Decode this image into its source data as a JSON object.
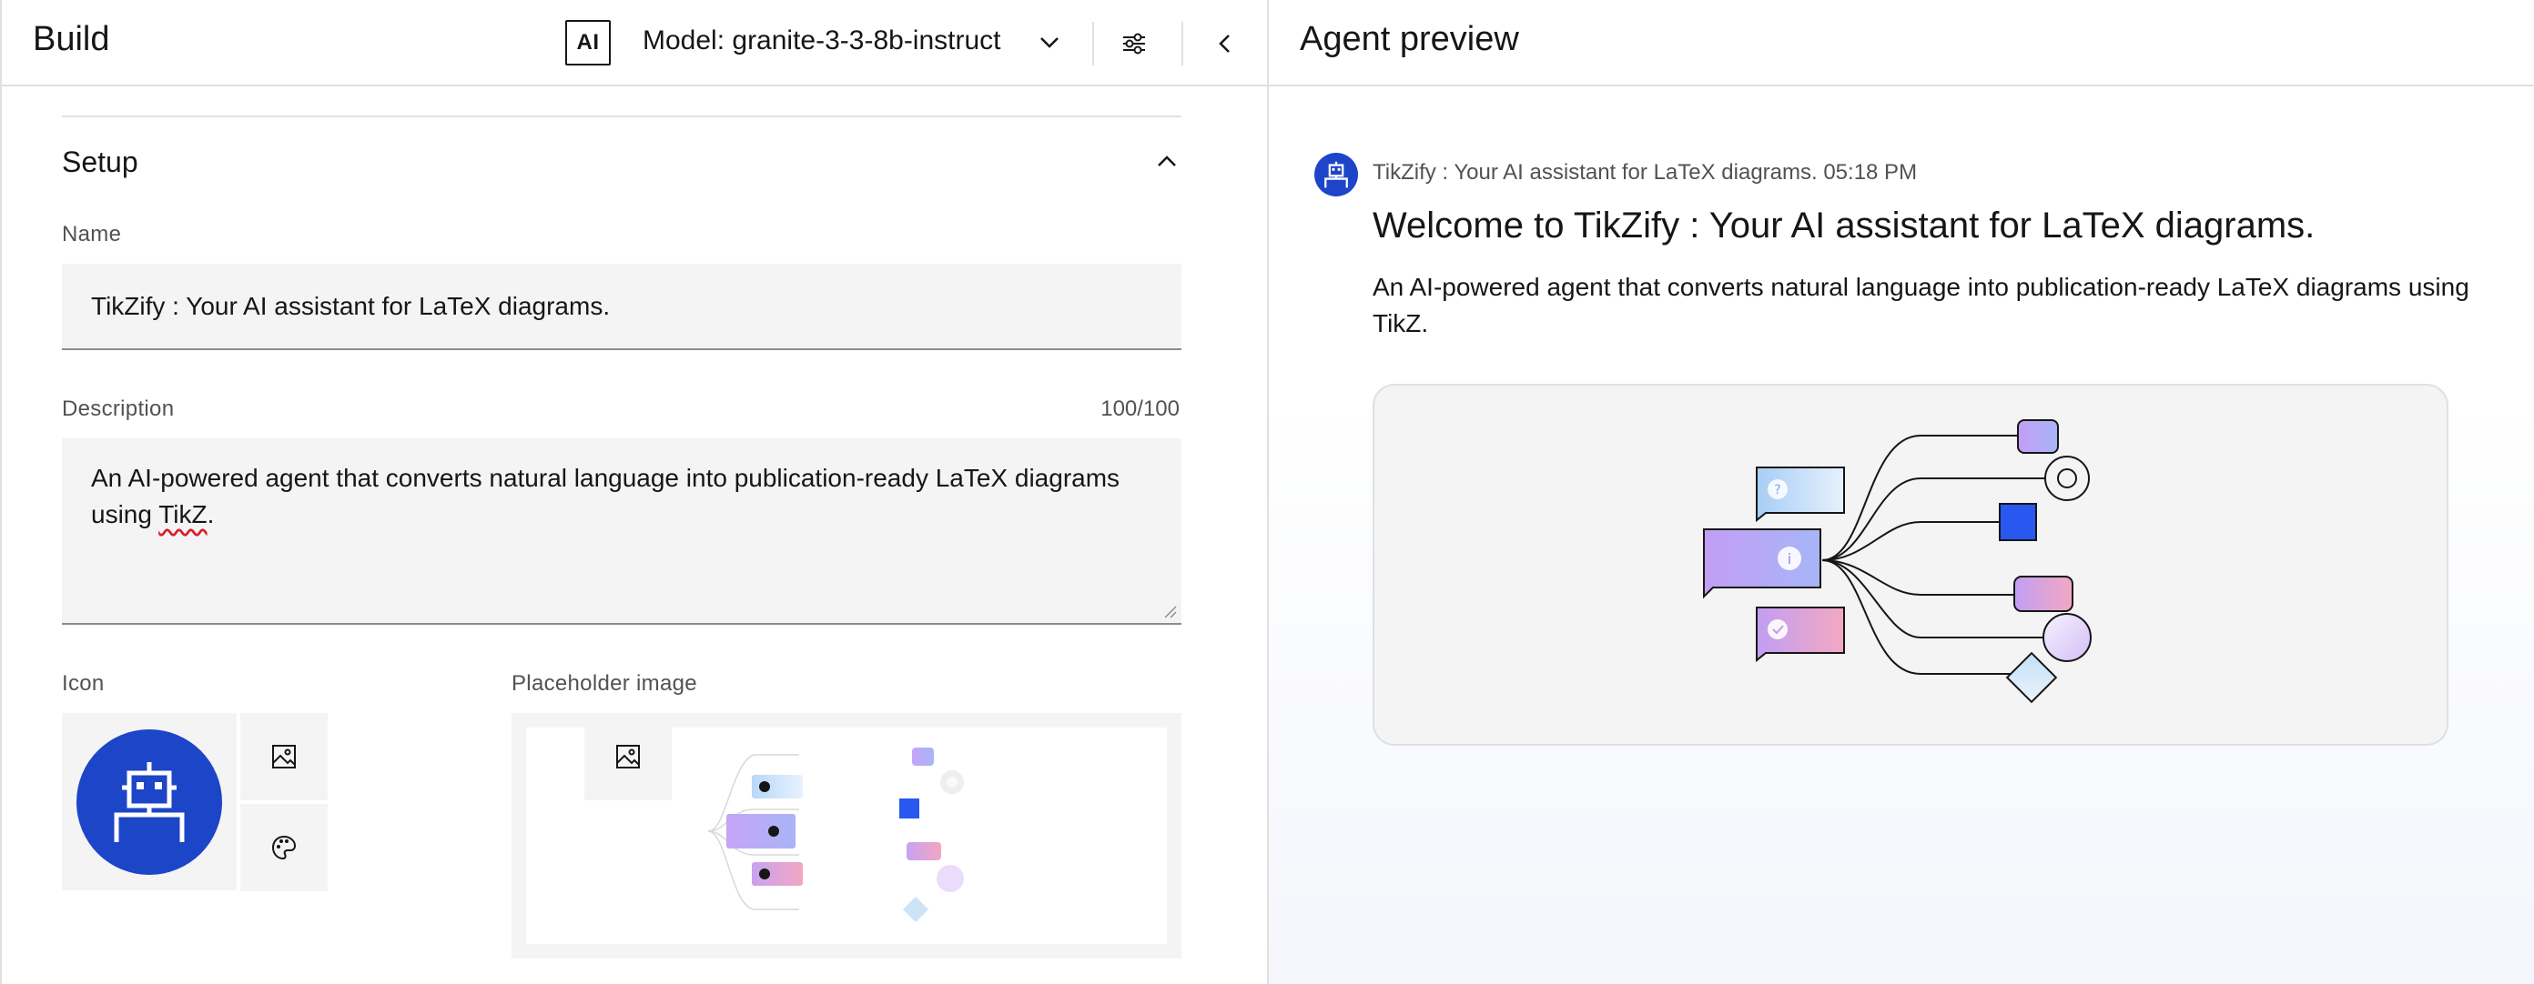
{
  "build_panel": {
    "title": "Build",
    "ai_badge": "AI",
    "model_label": "Model: granite-3-3-8b-instruct",
    "icons": {
      "model_dropdown": "chevron-down-icon",
      "settings": "settings-adjust-icon",
      "collapse": "chevron-left-icon"
    },
    "setup": {
      "title": "Setup",
      "name_label": "Name",
      "name_value": "TikZify : Your AI assistant for LaTeX diagrams.",
      "description_label": "Description",
      "description_counter": "100/100",
      "description_text_before": "An AI-powered agent that converts natural language into publication-ready LaTeX diagrams using ",
      "description_text_flagged": "TikZ",
      "description_text_after": ".",
      "icon_label": "Icon",
      "placeholder_label": "Placeholder image"
    }
  },
  "preview_panel": {
    "title": "Agent preview",
    "message": {
      "meta": "TikZify : Your AI assistant for LaTeX diagrams. 05:18 PM",
      "title": "Welcome to TikZify : Your AI assistant for LaTeX diagrams.",
      "body": "An AI-powered agent that converts natural language into publication-ready LaTeX diagrams using TikZ."
    }
  },
  "colors": {
    "accent_blue": "#1d45c8",
    "square_blue": "#2858f0",
    "field_bg": "#f4f4f4",
    "border": "#e0e0e0"
  }
}
